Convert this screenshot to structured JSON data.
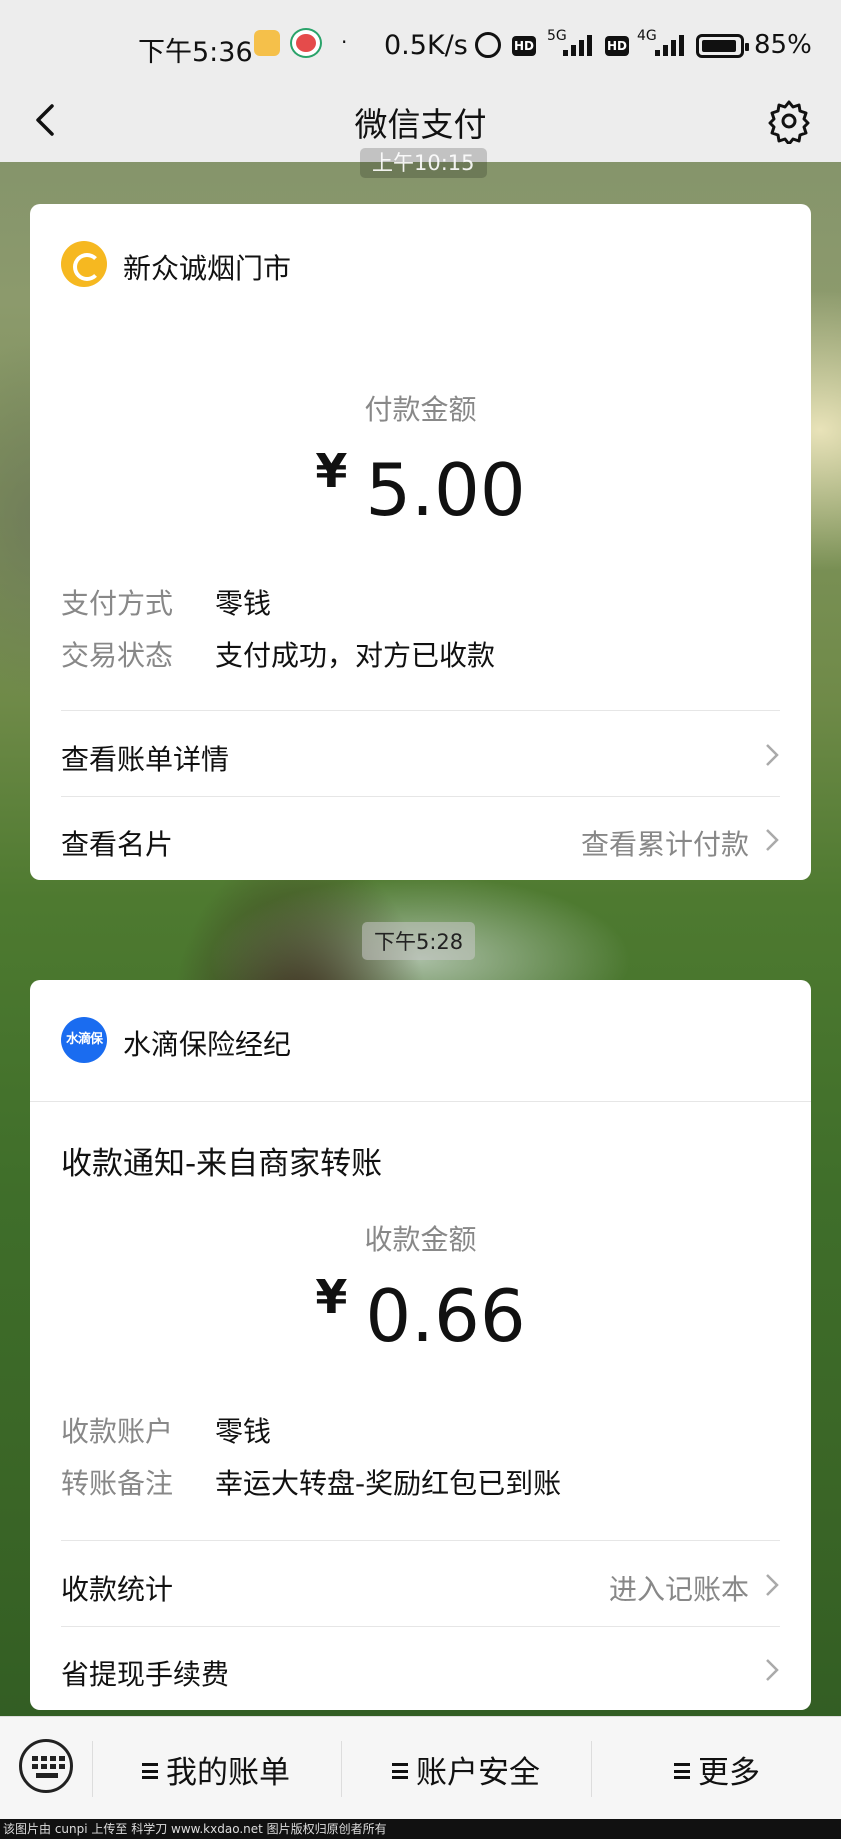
{
  "status_bar": {
    "time": "下午5:36",
    "dot": "·",
    "net_speed": "0.5K/s",
    "hd_label": "HD",
    "net1": "5G",
    "net2": "4G",
    "battery": "85%"
  },
  "nav": {
    "title": "微信支付"
  },
  "timestamps": {
    "top_partial": "上午10:15",
    "middle": "下午5:28"
  },
  "card1": {
    "merchant": "新众诚烟门市",
    "amount_label": "付款金额",
    "currency": "¥",
    "amount": "5.00",
    "fields": [
      {
        "key": "支付方式",
        "value": "零钱"
      },
      {
        "key": "交易状态",
        "value": "支付成功，对方已收款"
      }
    ],
    "rows": [
      {
        "label": "查看账单详情",
        "extra": ""
      },
      {
        "label": "查看名片",
        "extra": "查看累计付款"
      }
    ]
  },
  "card2": {
    "merchant": "水滴保险经纪",
    "logo_text": "水滴保",
    "notify_title": "收款通知-来自商家转账",
    "amount_label": "收款金额",
    "currency": "¥",
    "amount": "0.66",
    "fields": [
      {
        "key": "收款账户",
        "value": "零钱"
      },
      {
        "key": "转账备注",
        "value": "幸运大转盘-奖励红包已到账"
      }
    ],
    "rows": [
      {
        "label": "收款统计",
        "extra": "进入记账本"
      },
      {
        "label": "省提现手续费",
        "extra": ""
      }
    ]
  },
  "bottom_bar": {
    "items": [
      "我的账单",
      "账户安全",
      "更多"
    ]
  },
  "footer_text": "该图片由 cunpi 上传至 科学刀 www.kxdao.net 图片版权归原创者所有"
}
